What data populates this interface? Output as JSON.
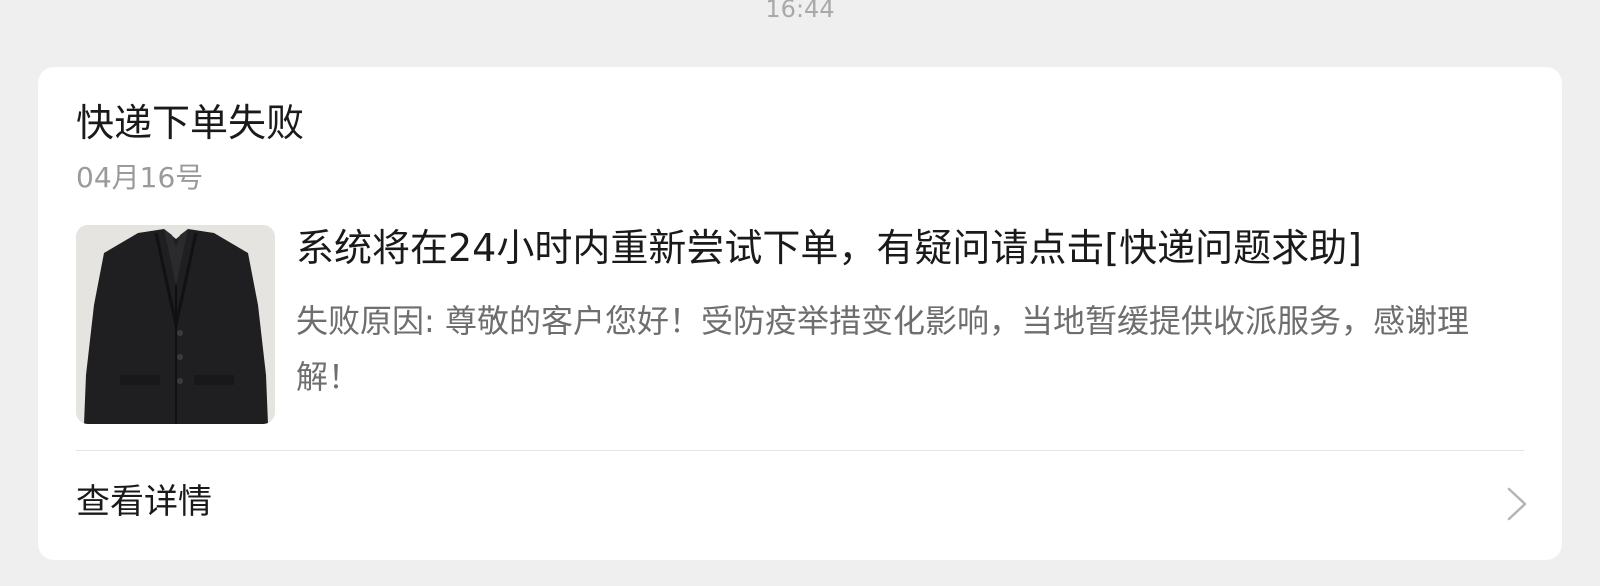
{
  "message": {
    "timestamp": "16:44"
  },
  "card": {
    "title": "快递下单失败",
    "date": "04月16号",
    "thumbnail_icon": "black-jacket-photo",
    "headline": "系统将在24小时内重新尝试下单，有疑问请点击[快递问题求助]",
    "reason": "失败原因: 尊敬的客户您好！受防疫举措变化影响，当地暂缓提供收派服务，感谢理解！",
    "details_label": "查看详情",
    "details_icon": "chevron-right-icon"
  },
  "colors": {
    "background": "#efefef",
    "card": "#ffffff",
    "title_text": "#1a1a1a",
    "secondary_text": "#9a9a9a",
    "body_text": "#6e6e6e"
  }
}
